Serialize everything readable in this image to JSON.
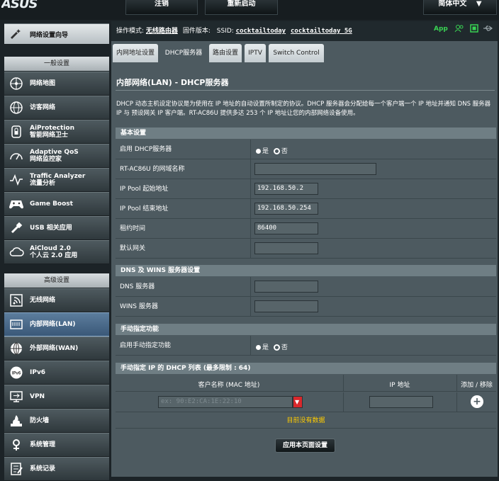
{
  "topbar": {
    "logo": "ASUS",
    "logout": "注销",
    "reboot": "重新启动",
    "language": "简体中文"
  },
  "sidebar": {
    "setup_wizard": "网络设置向导",
    "general_header": "一般设置",
    "general_items": [
      {
        "label": "网络地图",
        "icon": "network-map-icon"
      },
      {
        "label": "访客网络",
        "icon": "guest-network-icon"
      },
      {
        "label": "AiProtection",
        "sub": "智能网络卫士",
        "icon": "aiprotection-icon"
      },
      {
        "label": "Adaptive QoS",
        "sub": "网络监控家",
        "icon": "adaptive-qos-icon"
      },
      {
        "label": "Traffic Analyzer",
        "sub": "流量分析",
        "icon": "traffic-analyzer-icon"
      },
      {
        "label": "Game Boost",
        "icon": "game-boost-icon"
      },
      {
        "label": "USB 相关应用",
        "icon": "usb-icon"
      },
      {
        "label": "AiCloud 2.0",
        "sub": "个人云 2.0 应用",
        "icon": "aicloud-icon"
      }
    ],
    "advanced_header": "高级设置",
    "advanced_items": [
      {
        "label": "无线网络",
        "icon": "wireless-icon"
      },
      {
        "label": "内部网络(LAN)",
        "icon": "lan-icon",
        "selected": true
      },
      {
        "label": "外部网络(WAN)",
        "icon": "wan-icon"
      },
      {
        "label": "IPv6",
        "icon": "ipv6-icon"
      },
      {
        "label": "VPN",
        "icon": "vpn-icon"
      },
      {
        "label": "防火墙",
        "icon": "firewall-icon"
      },
      {
        "label": "系统管理",
        "icon": "administration-icon"
      },
      {
        "label": "系统记录",
        "icon": "system-log-icon"
      }
    ]
  },
  "status": {
    "mode_label": "操作模式:",
    "mode_value": "无线路由器",
    "firmware_label": "固件版本:",
    "ssid_label": "SSID:",
    "ssid1": "cocktailtoday",
    "ssid2": "cocktailtoday_5G",
    "app_label": "App"
  },
  "tabs": [
    "内网地址设置",
    "DHCP服务器",
    "路由设置",
    "IPTV",
    "Switch Control"
  ],
  "page": {
    "title": "内部网络(LAN) - DHCP服务器",
    "description": "DHCP 动态主机设定协议是为使用在 IP 地址的自动设置所制定的协议。DHCP 服务器会分配给每一个客户端一个 IP 地址并通知 DNS 服务器 IP 与 预设网关 IP 客户端。RT-AC86U 提供多达 253 个 IP 地址让您的内部网络设备使用。"
  },
  "basic": {
    "title": "基本设置",
    "enable_dhcp_label": "启用 DHCP服务器",
    "yes": "是",
    "no": "否",
    "domain_label": "RT-AC86U 的网域名称",
    "domain_value": "",
    "pool_start_label": "IP Pool 起始地址",
    "pool_start_value": "192.168.50.2",
    "pool_end_label": "IP Pool 结束地址",
    "pool_end_value": "192.168.50.254",
    "lease_label": "租约时间",
    "lease_value": "86400",
    "gateway_label": "默认网关",
    "gateway_value": ""
  },
  "dns": {
    "title": "DNS 及 WINS 服务器设置",
    "dns_label": "DNS 服务器",
    "wins_label": "WINS 服务器"
  },
  "manual": {
    "title": "手动指定功能",
    "enable_label": "启用手动指定功能",
    "yes": "是",
    "no": "否"
  },
  "manual_list": {
    "title": "手动指定 IP 的 DHCP 列表 (最多限制 : 64)",
    "col_client": "客户名称 (MAC 地址)",
    "col_ip": "IP 地址",
    "col_action": "添加 / 移除",
    "mac_placeholder": "ex: 90:E2:CA:1E:22:10",
    "empty_text": "目前没有数据"
  },
  "apply_label": "应用本页面设置",
  "colors": {
    "background": "#1c2327",
    "panel": "#4d5a60",
    "section_header": "#6f7e84",
    "accent_green": "#39d353",
    "empty_text": "#ffcc00",
    "dropdown_red": "#d9282c"
  }
}
